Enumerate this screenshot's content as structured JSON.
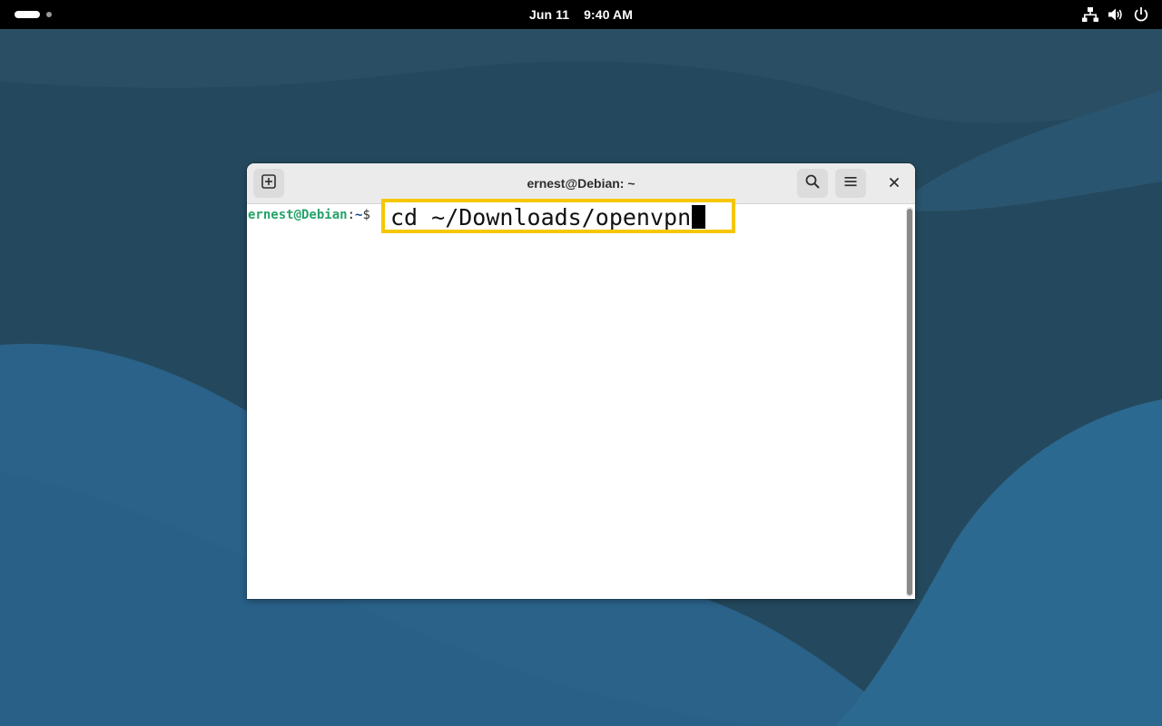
{
  "topbar": {
    "date": "Jun 11",
    "time": "9:40 AM",
    "activities_icon": "activities-pill-icon",
    "tray_icons": [
      "network-icon",
      "volume-icon",
      "power-icon"
    ]
  },
  "window": {
    "title": "ernest@Debian: ~",
    "new_tab_icon": "new-tab-icon",
    "search_icon": "search-icon",
    "menu_icon": "hamburger-menu-icon",
    "close_icon": "close-icon"
  },
  "terminal": {
    "prompt_user": "ernest@Debian",
    "prompt_sep": ":",
    "prompt_path": "~",
    "prompt_dollar": "$",
    "command": "cd ~/Downloads/openvpn"
  },
  "colors": {
    "highlight": "#f6c700",
    "prompt_user": "#26a269",
    "prompt_path": "#12488b",
    "topbar": "#000000"
  }
}
